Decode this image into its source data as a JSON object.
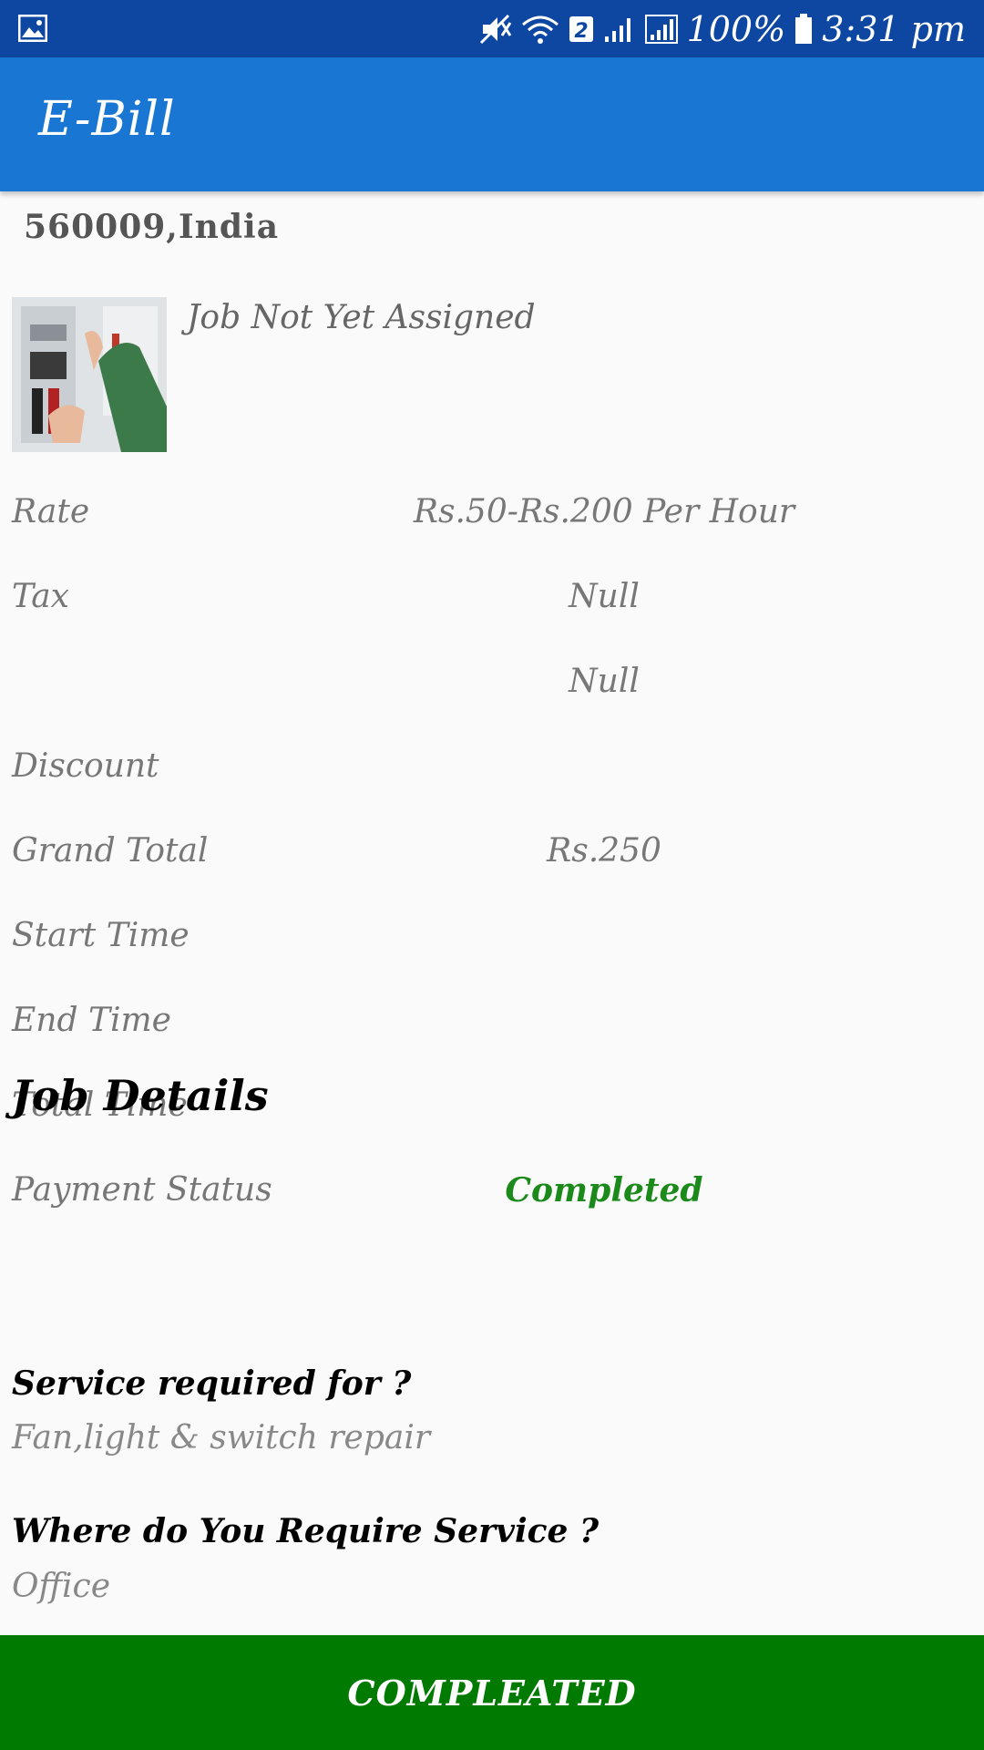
{
  "status_bar": {
    "battery_percent": "100%",
    "time": "3:31 pm",
    "sim_badge": "2"
  },
  "app_bar": {
    "title": "E-Bill"
  },
  "address": "560009,India",
  "job": {
    "status_text": "Job Not Yet Assigned"
  },
  "bill_rows": [
    {
      "label": "Rate",
      "value": "Rs.50-Rs.200 Per Hour"
    },
    {
      "label": "Tax",
      "value": "Null"
    },
    {
      "label": "",
      "value": "Null"
    },
    {
      "label": "Discount",
      "value": ""
    },
    {
      "label": "Grand Total",
      "value": "Rs.250"
    },
    {
      "label": "Start Time",
      "value": ""
    },
    {
      "label": "End Time",
      "value": ""
    },
    {
      "label": "Total Time",
      "value": ""
    },
    {
      "label": "Payment Status",
      "value": "Completed"
    }
  ],
  "job_details": {
    "title": "Job Details",
    "items": [
      {
        "question": "Service required for ?",
        "answer": "Fan,light & switch repair"
      },
      {
        "question": "Where do You Require Service ?",
        "answer": "Office"
      }
    ]
  },
  "bottom_button": {
    "label": "COMPLEATED"
  },
  "colors": {
    "status_bar": "#0d47a1",
    "app_bar": "#1976d2",
    "button": "#007a00",
    "completed_text": "#1b8a1b"
  }
}
